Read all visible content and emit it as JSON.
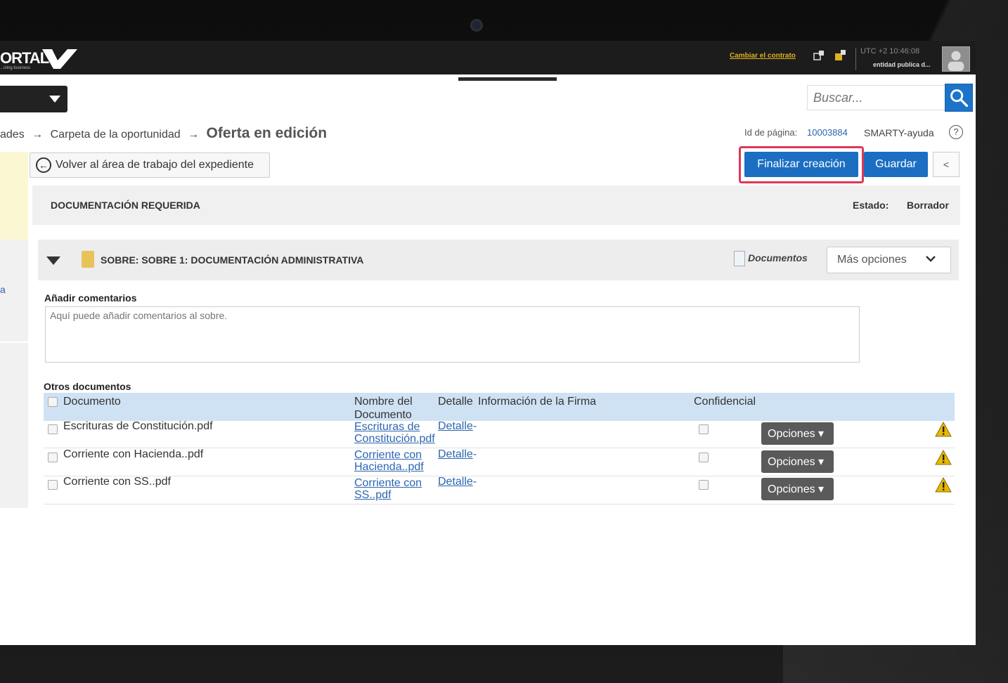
{
  "header": {
    "logo_text": "ORTAL",
    "logo_sub": "...cting business",
    "change_contract": "Cambiar el contrato",
    "utc": "UTC +2 10:46:08",
    "entity": "entidad publica d..."
  },
  "search": {
    "placeholder": "Buscar..."
  },
  "breadcrumb": {
    "item1": "ades",
    "item2": "Carpeta de la oportunidad",
    "current": "Oferta en edición",
    "arrow": "→"
  },
  "page_info": {
    "page_id_label": "Id de página:",
    "page_id_value": "10003884",
    "help_label": "SMARTY-ayuda",
    "help_icon": "?"
  },
  "sidebar": {
    "link_fragment": "a"
  },
  "actions": {
    "back_label": "Volver al área de trabajo del expediente",
    "finalize_label": "Finalizar creación",
    "save_label": "Guardar",
    "collapse_label": "<"
  },
  "section": {
    "title": "DOCUMENTACIÓN REQUERIDA",
    "state_label": "Estado:",
    "state_value": "Borrador"
  },
  "envelope": {
    "title": "SOBRE: SOBRE 1: DOCUMENTACIÓN ADMINISTRATIVA",
    "documents_link": "Documentos",
    "more_options": "Más opciones"
  },
  "comments": {
    "label": "Añadir comentarios",
    "placeholder": "Aquí puede añadir comentarios al sobre."
  },
  "table": {
    "title": "Otros documentos",
    "headers": {
      "document": "Documento",
      "name": "Nombre del Documento",
      "detail": "Detalle",
      "signature": "Información de la Firma",
      "confidential": "Confidencial"
    },
    "rows": [
      {
        "document": "Escrituras de Constitución.pdf",
        "name_line1": "Escrituras de",
        "name_line2": "Constitución.pdf",
        "detail": "Detalle",
        "dash": "-",
        "options": "Opciones"
      },
      {
        "document": "Corriente con Hacienda..pdf",
        "name_line1": "Corriente con",
        "name_line2": "Hacienda..pdf",
        "detail": "Detalle",
        "dash": "-",
        "options": "Opciones"
      },
      {
        "document": "Corriente con SS..pdf",
        "name_line1": "Corriente con",
        "name_line2": "SS..pdf",
        "detail": "Detalle",
        "dash": "-",
        "options": "Opciones"
      }
    ]
  },
  "colors": {
    "primary": "#1b6ec2",
    "highlight": "#e0365a",
    "table_header": "#cfe2f3",
    "options_button": "#5a5a5a",
    "warning": "#e6b800"
  },
  "icons": [
    "camera-icon",
    "search-icon",
    "back-arrow-icon",
    "folder-icon",
    "document-icon",
    "chevron-down-icon",
    "warning-icon",
    "help-icon",
    "avatar-icon"
  ]
}
